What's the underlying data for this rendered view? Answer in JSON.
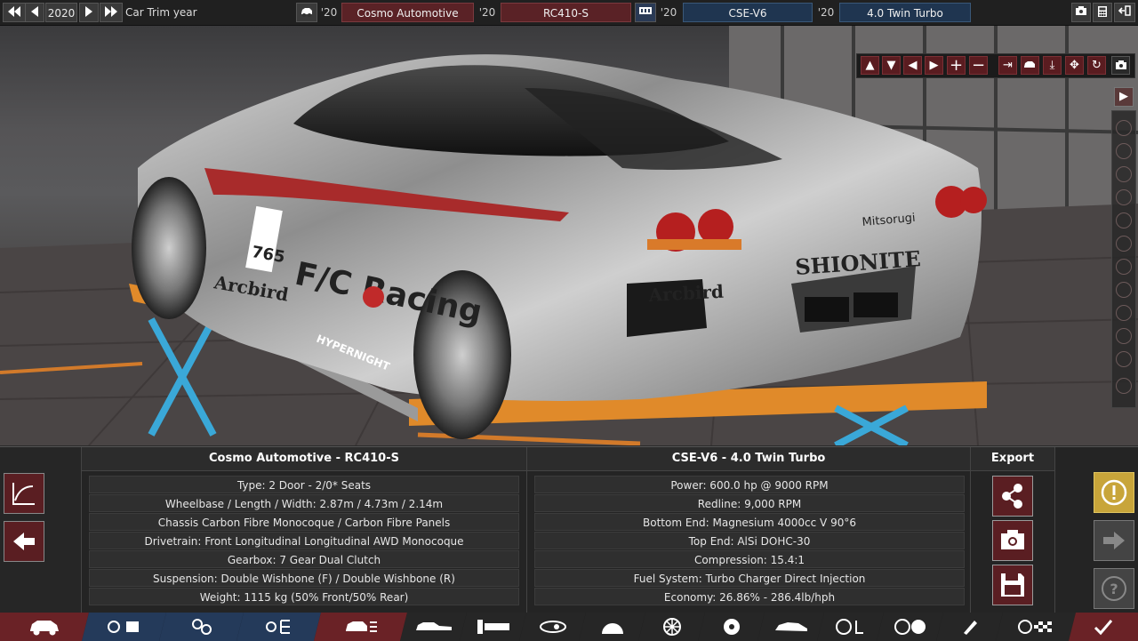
{
  "topbar": {
    "year": "2020",
    "trim_year_label": "Car Trim year",
    "model_year": "'20",
    "company": "Cosmo Automotive",
    "trim_year": "'20",
    "trim": "RC410-S",
    "engine_family_year": "'20",
    "engine_family": "CSE-V6",
    "variant_year": "'20",
    "variant": "4.0 Twin Turbo"
  },
  "camera": {
    "buttons": [
      "▲",
      "▼",
      "◀",
      "▶",
      "+",
      "−"
    ]
  },
  "car_panel": {
    "title": "Cosmo Automotive - RC410-S",
    "rows": [
      "Type: 2 Door - 2/0* Seats",
      "Wheelbase / Length / Width: 2.87m / 4.73m / 2.14m",
      "Chassis Carbon Fibre Monocoque / Carbon Fibre Panels",
      "Drivetrain: Front Longitudinal Longitudinal AWD Monocoque",
      "Gearbox: 7 Gear Dual Clutch",
      "Suspension: Double Wishbone (F) / Double Wishbone (R)",
      "Weight: 1115 kg (50% Front/50% Rear)"
    ]
  },
  "engine_panel": {
    "title": "CSE-V6 - 4.0 Twin Turbo",
    "rows": [
      "Power: 600.0 hp @ 9000 RPM",
      "Redline:  9,000 RPM",
      "Bottom End: Magnesium 4000cc V 90°6",
      "Top End: AlSi DOHC-30",
      "Compression: 15.4:1",
      "Fuel System: Turbo Charger Direct Injection",
      "Economy: 26.86% - 286.4lb/hph"
    ]
  },
  "export_panel": {
    "title": "Export"
  },
  "car_decals": {
    "side_brand": "F/C Racing",
    "rear_brand": "SHIONITE",
    "rear_brand2": "Mitsorugi",
    "side_brand2": "Arcbird",
    "rear_brand3": "Arcbird",
    "skirt": "HYPERNIGHT",
    "number": "765"
  },
  "colors": {
    "maroon": "#5a2226",
    "navy": "#1f3550",
    "warning": "#c8a53a"
  }
}
